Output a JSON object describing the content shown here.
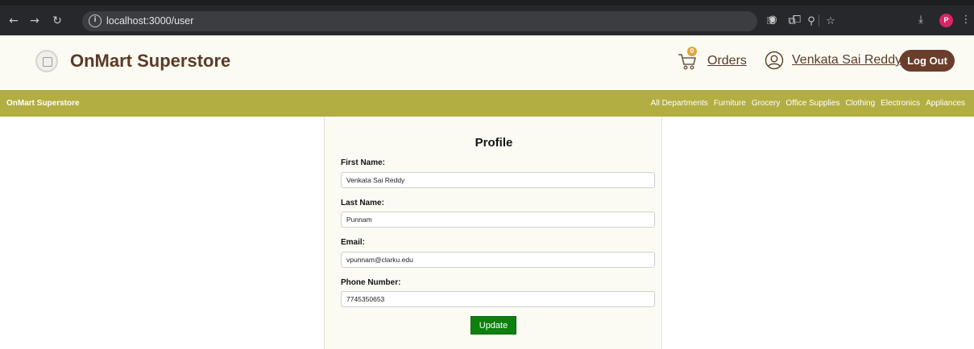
{
  "browser": {
    "url": "localhost:3000/user",
    "profile_initial": "P"
  },
  "header": {
    "brand": "OnMart Superstore",
    "cart_count": "0",
    "orders_label": "Orders",
    "user_name": "Venkata Sai Reddy",
    "logout_label": "Log Out"
  },
  "category_bar": {
    "brand": "OnMart Superstore",
    "links": [
      "All Departments",
      "Furniture",
      "Grocery",
      "Office Supplies",
      "Clothing",
      "Electronics",
      "Appliances"
    ]
  },
  "profile": {
    "title": "Profile",
    "fields": [
      {
        "label": "First Name:",
        "value": "Venkata Sai Reddy"
      },
      {
        "label": "Last Name:",
        "value": "Punnam"
      },
      {
        "label": "Email:",
        "value": "vpunnam@clarku.edu"
      },
      {
        "label": "Phone Number:",
        "value": "7745350653"
      }
    ],
    "update_label": "Update"
  },
  "colors": {
    "brand_brown": "#5b3a26",
    "category_bar": "#b2ae42",
    "update_green": "#0d800e",
    "logout_brown": "#6a3e2a"
  }
}
